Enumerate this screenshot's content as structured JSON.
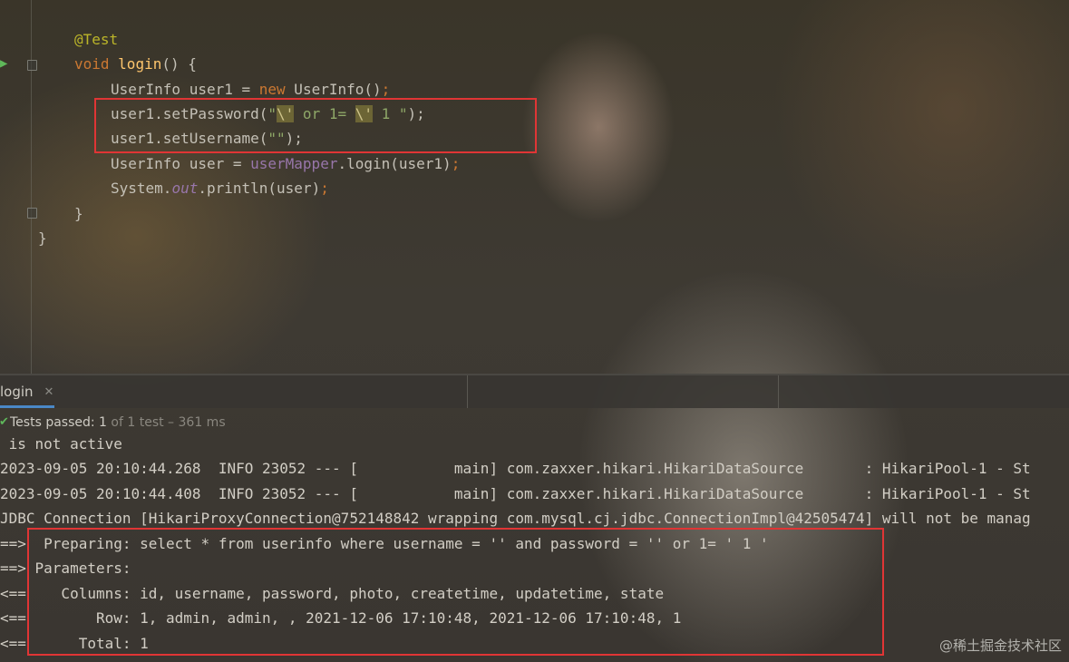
{
  "editor": {
    "lines": {
      "l1": {
        "ann": "@Test"
      },
      "l2": {
        "kw": "void",
        "fn": "login",
        "rest": "() {"
      },
      "l3": {
        "a": "UserInfo user1 = ",
        "kw": "new",
        "b": " UserInfo()",
        "semi": ";"
      },
      "l4": {
        "a": "user1.setPassword(",
        "s1": "\"",
        "e1": "\\'",
        "s2": " or 1= ",
        "e2": "\\'",
        "s3": " 1 \"",
        "b": ");"
      },
      "l5": {
        "a": "user1.setUsername(",
        "s": "\"\"",
        "b": ");"
      },
      "l6": {
        "a": "UserInfo user = ",
        "fld": "userMapper",
        "b": ".login(user1)",
        "semi": ";"
      },
      "l7": {
        "a": "System.",
        "fld": "out",
        "b": ".println(user)",
        "semi": ";"
      },
      "l8": "}",
      "l9": "}"
    }
  },
  "run_panel": {
    "tab_label": "login",
    "status": {
      "prefix": "Tests passed: ",
      "passed": "1",
      "of_text": " of 1 test",
      "dash": " – 361 ms"
    }
  },
  "console": {
    "lines": [
      " is not active",
      "2023-09-05 20:10:44.268  INFO 23052 --- [           main] com.zaxxer.hikari.HikariDataSource       : HikariPool-1 - St",
      "2023-09-05 20:10:44.408  INFO 23052 --- [           main] com.zaxxer.hikari.HikariDataSource       : HikariPool-1 - St",
      "JDBC Connection [HikariProxyConnection@752148842 wrapping com.mysql.cj.jdbc.ConnectionImpl@42505474] will not be manag",
      "==>  Preparing: select * from userinfo where username = '' and password = '' or 1= ' 1 '",
      "==> Parameters: ",
      "<==    Columns: id, username, password, photo, createtime, updatetime, state",
      "<==        Row: 1, admin, admin, , 2021-12-06 17:10:48, 2021-12-06 17:10:48, 1",
      "<==      Total: 1"
    ]
  },
  "watermark": "@稀土掘金技术社区",
  "colors": {
    "highlight_box": "#e03535",
    "keyword": "#cc7832",
    "annotation": "#bbb529",
    "string": "#8fa868",
    "pass": "#5fb85a"
  }
}
